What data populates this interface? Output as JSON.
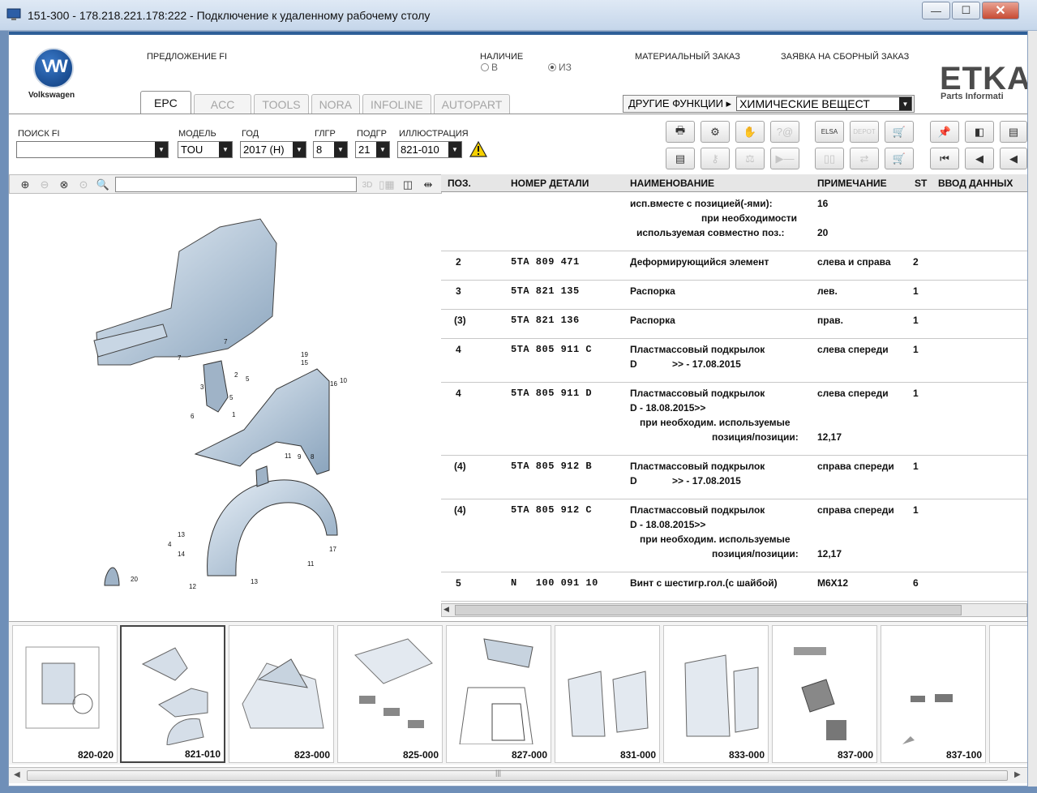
{
  "window": {
    "title": "151-300 - 178.218.221.178:222 - Подключение к удаленному рабочему столу",
    "buttons": {
      "minimize": "—",
      "maximize": "☐",
      "close": "✕"
    }
  },
  "brand": {
    "name": "Volkswagen",
    "logo_letters": "VW",
    "etka": "ETKA",
    "etka_sub": "Parts Informati"
  },
  "header": {
    "offer_fi": "ПРЕДЛОЖЕНИЕ FI",
    "availability": "НАЛИЧИЕ",
    "radio_b": "В",
    "radio_iz": "ИЗ",
    "material_order": "МАТЕРИАЛЬНЫЙ ЗАКАЗ",
    "assembly_order": "ЗАЯВКА НА СБОРНЫЙ ЗАКАЗ"
  },
  "tabs": [
    "EPC",
    "ACC",
    "TOOLS",
    "NORA",
    "INFOLINE",
    "AUTOPART"
  ],
  "other_functions": {
    "label": "ДРУГИЕ ФУНКЦИИ ▸",
    "value": "ХИМИЧЕСКИЕ ВЕЩЕСТ"
  },
  "search": {
    "fi_label": "ПОИСК FI",
    "fi_value": "",
    "model_label": "МОДЕЛЬ",
    "model_value": "TOU",
    "year_label": "ГОД",
    "year_value": "2017 (H)",
    "glgr_label": "ГЛГР",
    "glgr_value": "8",
    "podgr_label": "ПОДГР",
    "podgr_value": "21",
    "illus_label": "ИЛЛЮСТРАЦИЯ",
    "illus_value": "821-010"
  },
  "table": {
    "headers": {
      "pos": "ПОЗ.",
      "number": "НОМЕР ДЕТАЛИ",
      "name": "НАИМЕНОВАНИЕ",
      "note": "ПРИМЕЧАНИЕ",
      "st": "ST",
      "input": "ВВОД ДАННЫХ"
    },
    "rows": [
      {
        "pos": "",
        "number": "",
        "name": "исп.вместе с позицией(-ями):",
        "name2": "при необходимости",
        "name3": "используемая совместно поз.:",
        "note": "16",
        "note2": "",
        "note3": "20",
        "qty": ""
      },
      {
        "pos": "2",
        "number": "5TA 809 471",
        "name": "Деформирующийся элемент",
        "note": "слева и справа",
        "qty": "2"
      },
      {
        "pos": "3",
        "number": "5TA 821 135",
        "name": "Распорка",
        "note": "лев.",
        "qty": "1"
      },
      {
        "pos": "(3)",
        "number": "5TA 821 136",
        "name": "Распорка",
        "note": "прав.",
        "qty": "1"
      },
      {
        "pos": "4",
        "number": "5TA 805 911 C",
        "name": "Пластмассовый подкрылок",
        "name2": "D             >> - 17.08.2015",
        "note": "слева спереди",
        "qty": "1"
      },
      {
        "pos": "4",
        "number": "5TA 805 911 D",
        "name": "Пластмассовый подкрылок",
        "name2": "D - 18.08.2015>>",
        "name3": "при необходим. используемые",
        "name4": "позиция/позиции:",
        "note": "слева спереди",
        "note4": "12,17",
        "qty": "1"
      },
      {
        "pos": "(4)",
        "number": "5TA 805 912 B",
        "name": "Пластмассовый подкрылок",
        "name2": "D             >> - 17.08.2015",
        "note": "справа спереди",
        "qty": "1"
      },
      {
        "pos": "(4)",
        "number": "5TA 805 912 C",
        "name": "Пластмассовый подкрылок",
        "name2": "D - 18.08.2015>>",
        "name3": "при необходим. используемые",
        "name4": "позиция/позиции:",
        "note": "справа спереди",
        "note4": "12,17",
        "qty": "1"
      },
      {
        "pos": "5",
        "number": "N   100 091 10",
        "name": "Винт с шестигр.гол.(с шайбой)",
        "note": "M6X12",
        "qty": "6"
      }
    ]
  },
  "illustration_callouts": [
    "7",
    "2",
    "5",
    "19",
    "15",
    "10",
    "16",
    "7",
    "3",
    "5",
    "6",
    "1",
    "11",
    "9",
    "8",
    "13",
    "4",
    "14",
    "17",
    "11",
    "12",
    "13",
    "20"
  ],
  "thumbnails": [
    "820-020",
    "821-010",
    "823-000",
    "825-000",
    "827-000",
    "831-000",
    "833-000",
    "837-000",
    "837-100"
  ],
  "colors": {
    "title_strip": "#2e5f98",
    "close_btn": "#c74b33",
    "selected_thumb": "#444444"
  }
}
